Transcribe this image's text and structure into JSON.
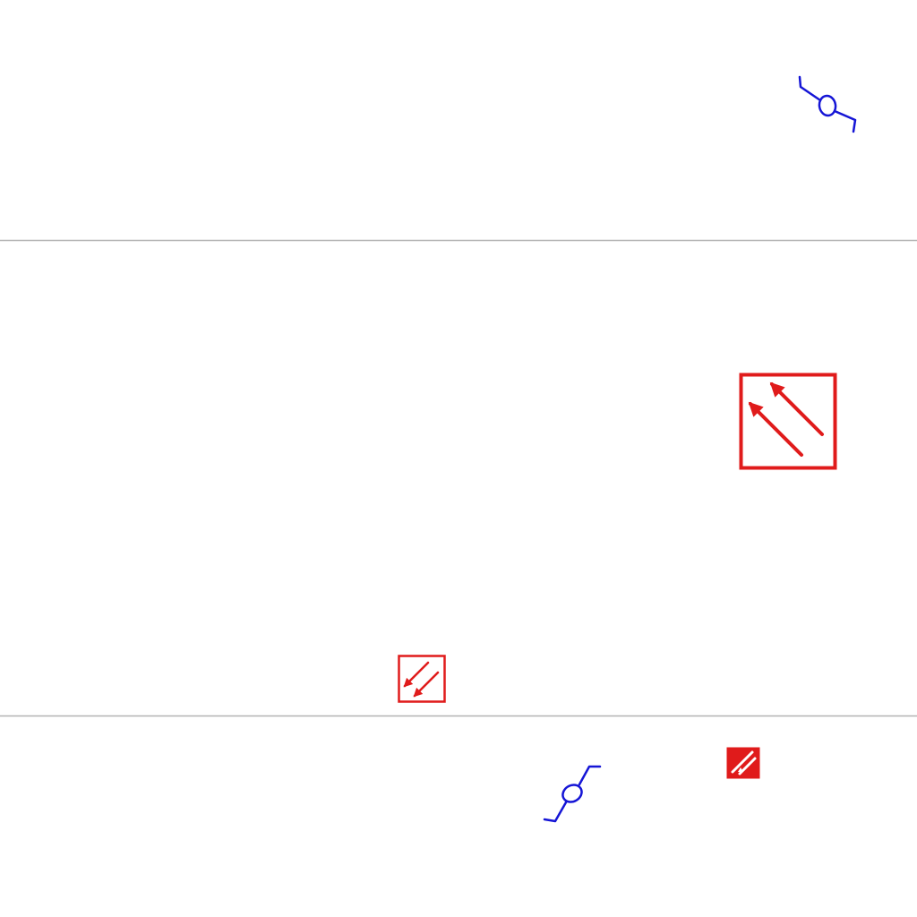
{
  "colors": {
    "background": "#ffffff",
    "divider": "#b3b3b3",
    "valve_symbol": "#1515d6",
    "arrow_box": "#e01b1b"
  },
  "symbols": [
    {
      "name": "valve-symbol-top-right",
      "icon": "blue-valve-icon"
    },
    {
      "name": "arrow-box-large",
      "icon": "double-arrow-up-left-icon"
    },
    {
      "name": "arrow-box-small",
      "icon": "double-arrow-down-left-icon"
    },
    {
      "name": "valve-symbol-bottom",
      "icon": "blue-valve-icon"
    },
    {
      "name": "filled-arrow-box",
      "icon": "filled-diagonal-arrow-icon"
    }
  ]
}
